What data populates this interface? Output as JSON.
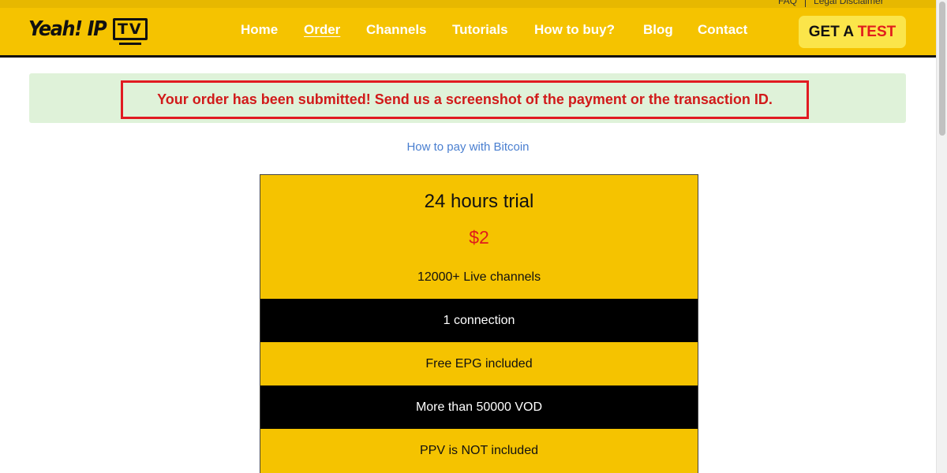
{
  "top_links": [
    "FAQ",
    "Legal Disclaimer"
  ],
  "logo": {
    "text": "Yeah! IP",
    "tv_text": "TV"
  },
  "nav": [
    {
      "label": "Home"
    },
    {
      "label": "Order",
      "active": true
    },
    {
      "label": "Channels"
    },
    {
      "label": "Tutorials"
    },
    {
      "label": "How to buy?"
    },
    {
      "label": "Blog"
    },
    {
      "label": "Contact"
    }
  ],
  "cta": {
    "part1": "GET A ",
    "part2": "TEST"
  },
  "alert": {
    "message": "Your order has been submitted! Send us a screenshot of the payment or the transaction ID."
  },
  "bitcoin_link": "How to pay with Bitcoin",
  "plan": {
    "title": "24 hours trial",
    "price": "$2",
    "features": [
      "12000+ Live channels",
      "1 connection",
      "Free EPG included",
      "More than 50000 VOD",
      "PPV is NOT included"
    ]
  },
  "colors": {
    "brand_yellow": "#f5c300",
    "alert_red": "#e11b22",
    "alert_bg": "#dff2d9",
    "link_blue": "#4a7fd0",
    "price_red": "#e01b1b"
  }
}
